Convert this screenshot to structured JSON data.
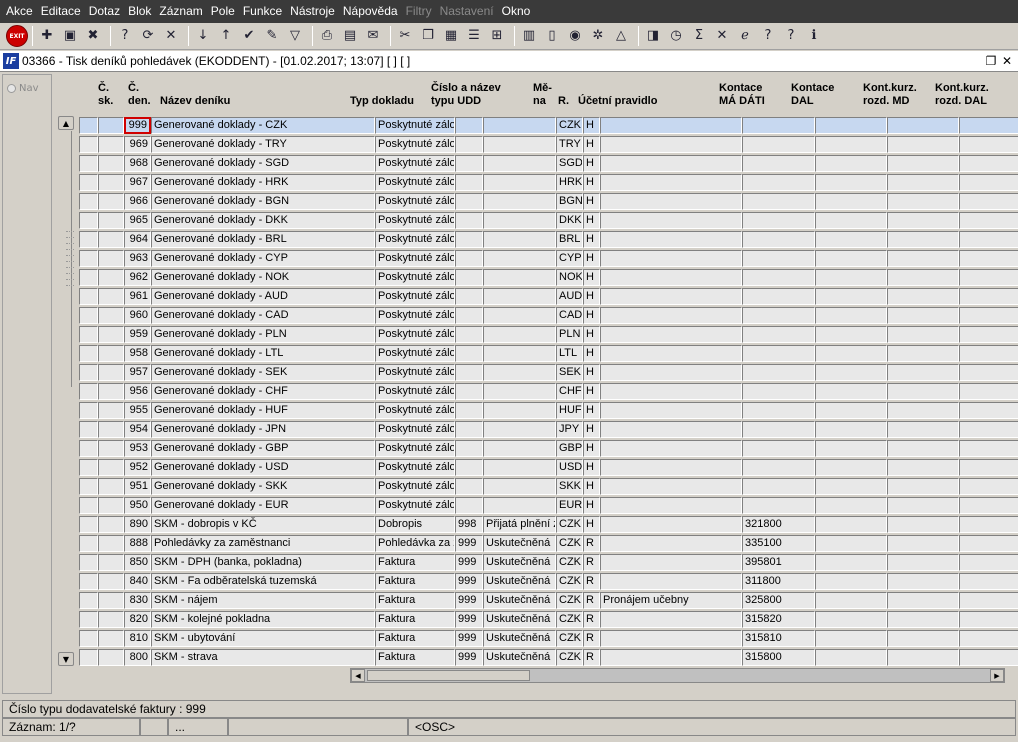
{
  "menu": [
    {
      "label": "Akce",
      "enabled": true
    },
    {
      "label": "Editace",
      "enabled": true
    },
    {
      "label": "Dotaz",
      "enabled": true
    },
    {
      "label": "Blok",
      "enabled": true
    },
    {
      "label": "Záznam",
      "enabled": true
    },
    {
      "label": "Pole",
      "enabled": true
    },
    {
      "label": "Funkce",
      "enabled": true
    },
    {
      "label": "Nástroje",
      "enabled": true
    },
    {
      "label": "Nápověda",
      "enabled": true
    },
    {
      "label": "Filtry",
      "enabled": false
    },
    {
      "label": "Nastavení",
      "enabled": false
    },
    {
      "label": "Okno",
      "enabled": true
    }
  ],
  "toolbar": {
    "exit_label": "EXIT",
    "icons": [
      {
        "name": "sep"
      },
      {
        "name": "insert-record-icon",
        "glyph": "✚"
      },
      {
        "name": "save-record-icon",
        "glyph": "▣"
      },
      {
        "name": "delete-record-icon",
        "glyph": "✖"
      },
      {
        "name": "sep"
      },
      {
        "name": "enter-query-icon",
        "glyph": "?"
      },
      {
        "name": "execute-query-icon",
        "glyph": "⟳"
      },
      {
        "name": "cancel-query-icon",
        "glyph": "✕"
      },
      {
        "name": "sep"
      },
      {
        "name": "sort-ascending-icon",
        "glyph": "↓"
      },
      {
        "name": "sort-descending-icon",
        "glyph": "↑"
      },
      {
        "name": "check-icon",
        "glyph": "✔"
      },
      {
        "name": "wrench-icon",
        "glyph": "✎"
      },
      {
        "name": "filter-icon",
        "glyph": "▽"
      },
      {
        "name": "sep"
      },
      {
        "name": "print-icon",
        "glyph": "⎙"
      },
      {
        "name": "print-preview-icon",
        "glyph": "▤"
      },
      {
        "name": "mail-icon",
        "glyph": "✉"
      },
      {
        "name": "sep"
      },
      {
        "name": "cut-icon",
        "glyph": "✂"
      },
      {
        "name": "copy-icon",
        "glyph": "❐"
      },
      {
        "name": "paste-icon",
        "glyph": "▦"
      },
      {
        "name": "list-icon",
        "glyph": "☰"
      },
      {
        "name": "tree-icon",
        "glyph": "⊞"
      },
      {
        "name": "sep"
      },
      {
        "name": "calculator-icon",
        "glyph": "▥"
      },
      {
        "name": "document-icon",
        "glyph": "▯"
      },
      {
        "name": "globe-icon",
        "glyph": "◉"
      },
      {
        "name": "settings-icon",
        "glyph": "✲"
      },
      {
        "name": "triangle-icon",
        "glyph": "△"
      },
      {
        "name": "sep"
      },
      {
        "name": "chart-icon",
        "glyph": "◨"
      },
      {
        "name": "clock-icon",
        "glyph": "◷"
      },
      {
        "name": "sum-icon",
        "glyph": "Σ"
      },
      {
        "name": "excel-icon",
        "glyph": "✕"
      },
      {
        "name": "internet-icon",
        "glyph": "ℯ"
      },
      {
        "name": "help-icon",
        "glyph": "?"
      },
      {
        "name": "question-icon",
        "glyph": "?"
      },
      {
        "name": "info-icon",
        "glyph": "ℹ"
      }
    ]
  },
  "window": {
    "icon_label": "IF",
    "title": "03366 - Tisk deníků pohledávek (EKODDENT) - [01.02.2017; 13:07] [ ] [ ]",
    "restore_glyph": "❐",
    "close_glyph": "✕"
  },
  "nav_label": "Nav",
  "columns": [
    {
      "key": "sk",
      "line1": "Č.",
      "line2": "sk."
    },
    {
      "key": "den",
      "line1": "Č.",
      "line2": "den."
    },
    {
      "key": "nazev",
      "line1": "",
      "line2": "Název deníku"
    },
    {
      "key": "typ",
      "line1": "",
      "line2": "Typ dokladu"
    },
    {
      "key": "udd",
      "line1": "Číslo a název",
      "line2": "typu UDD"
    },
    {
      "key": "mena",
      "line1": "Mě-",
      "line2": "na"
    },
    {
      "key": "r",
      "line1": "",
      "line2": "R."
    },
    {
      "key": "pravidlo",
      "line1": "",
      "line2": "Účetní pravidlo"
    },
    {
      "key": "madati",
      "line1": "Kontace",
      "line2": "MÁ DÁTI"
    },
    {
      "key": "dal",
      "line1": "Kontace",
      "line2": "DAL"
    },
    {
      "key": "kmd",
      "line1": "Kont.kurz.",
      "line2": "rozd. MD"
    },
    {
      "key": "kdal",
      "line1": "Kont.kurz.",
      "line2": "rozd. DAL"
    }
  ],
  "rows": [
    {
      "den": "999",
      "nazev": "Generované doklady - CZK",
      "typ": "Poskytnuté zálo",
      "udd_no": "",
      "udd_name": "",
      "mena": "CZK",
      "r": "H",
      "pravidlo": "",
      "madati": "",
      "selected": true
    },
    {
      "den": "969",
      "nazev": "Generované doklady - TRY",
      "typ": "Poskytnuté zálo",
      "udd_no": "",
      "udd_name": "",
      "mena": "TRY",
      "r": "H",
      "pravidlo": "",
      "madati": ""
    },
    {
      "den": "968",
      "nazev": "Generované doklady - SGD",
      "typ": "Poskytnuté zálo",
      "udd_no": "",
      "udd_name": "",
      "mena": "SGD",
      "r": "H",
      "pravidlo": "",
      "madati": ""
    },
    {
      "den": "967",
      "nazev": "Generované doklady - HRK",
      "typ": "Poskytnuté zálo",
      "udd_no": "",
      "udd_name": "",
      "mena": "HRK",
      "r": "H",
      "pravidlo": "",
      "madati": ""
    },
    {
      "den": "966",
      "nazev": "Generované doklady - BGN",
      "typ": "Poskytnuté zálo",
      "udd_no": "",
      "udd_name": "",
      "mena": "BGN",
      "r": "H",
      "pravidlo": "",
      "madati": ""
    },
    {
      "den": "965",
      "nazev": "Generované doklady - DKK",
      "typ": "Poskytnuté zálo",
      "udd_no": "",
      "udd_name": "",
      "mena": "DKK",
      "r": "H",
      "pravidlo": "",
      "madati": ""
    },
    {
      "den": "964",
      "nazev": "Generované doklady - BRL",
      "typ": "Poskytnuté zálo",
      "udd_no": "",
      "udd_name": "",
      "mena": "BRL",
      "r": "H",
      "pravidlo": "",
      "madati": ""
    },
    {
      "den": "963",
      "nazev": "Generované doklady - CYP",
      "typ": "Poskytnuté zálo",
      "udd_no": "",
      "udd_name": "",
      "mena": "CYP",
      "r": "H",
      "pravidlo": "",
      "madati": ""
    },
    {
      "den": "962",
      "nazev": "Generované doklady - NOK",
      "typ": "Poskytnuté zálo",
      "udd_no": "",
      "udd_name": "",
      "mena": "NOK",
      "r": "H",
      "pravidlo": "",
      "madati": ""
    },
    {
      "den": "961",
      "nazev": "Generované doklady - AUD",
      "typ": "Poskytnuté zálo",
      "udd_no": "",
      "udd_name": "",
      "mena": "AUD",
      "r": "H",
      "pravidlo": "",
      "madati": ""
    },
    {
      "den": "960",
      "nazev": "Generované doklady - CAD",
      "typ": "Poskytnuté zálo",
      "udd_no": "",
      "udd_name": "",
      "mena": "CAD",
      "r": "H",
      "pravidlo": "",
      "madati": ""
    },
    {
      "den": "959",
      "nazev": "Generované doklady - PLN",
      "typ": "Poskytnuté zálo",
      "udd_no": "",
      "udd_name": "",
      "mena": "PLN",
      "r": "H",
      "pravidlo": "",
      "madati": ""
    },
    {
      "den": "958",
      "nazev": "Generované doklady - LTL",
      "typ": "Poskytnuté zálo",
      "udd_no": "",
      "udd_name": "",
      "mena": "LTL",
      "r": "H",
      "pravidlo": "",
      "madati": ""
    },
    {
      "den": "957",
      "nazev": "Generované doklady - SEK",
      "typ": "Poskytnuté zálo",
      "udd_no": "",
      "udd_name": "",
      "mena": "SEK",
      "r": "H",
      "pravidlo": "",
      "madati": ""
    },
    {
      "den": "956",
      "nazev": "Generované doklady - CHF",
      "typ": "Poskytnuté zálo",
      "udd_no": "",
      "udd_name": "",
      "mena": "CHF",
      "r": "H",
      "pravidlo": "",
      "madati": ""
    },
    {
      "den": "955",
      "nazev": "Generované doklady - HUF",
      "typ": "Poskytnuté zálo",
      "udd_no": "",
      "udd_name": "",
      "mena": "HUF",
      "r": "H",
      "pravidlo": "",
      "madati": ""
    },
    {
      "den": "954",
      "nazev": "Generované doklady - JPN",
      "typ": "Poskytnuté zálo",
      "udd_no": "",
      "udd_name": "",
      "mena": "JPY",
      "r": "H",
      "pravidlo": "",
      "madati": ""
    },
    {
      "den": "953",
      "nazev": "Generované doklady - GBP",
      "typ": "Poskytnuté zálo",
      "udd_no": "",
      "udd_name": "",
      "mena": "GBP",
      "r": "H",
      "pravidlo": "",
      "madati": ""
    },
    {
      "den": "952",
      "nazev": "Generované doklady - USD",
      "typ": "Poskytnuté zálo",
      "udd_no": "",
      "udd_name": "",
      "mena": "USD",
      "r": "H",
      "pravidlo": "",
      "madati": ""
    },
    {
      "den": "951",
      "nazev": "Generované doklady - SKK",
      "typ": "Poskytnuté zálo",
      "udd_no": "",
      "udd_name": "",
      "mena": "SKK",
      "r": "H",
      "pravidlo": "",
      "madati": ""
    },
    {
      "den": "950",
      "nazev": "Generované doklady - EUR",
      "typ": "Poskytnuté zálo",
      "udd_no": "",
      "udd_name": "",
      "mena": "EUR",
      "r": "H",
      "pravidlo": "",
      "madati": ""
    },
    {
      "den": "890",
      "nazev": "SKM - dobropis v KČ",
      "typ": "Dobropis",
      "udd_no": "998",
      "udd_name": "Přijatá plnění z",
      "mena": "CZK",
      "r": "H",
      "pravidlo": "",
      "madati": "321800"
    },
    {
      "den": "888",
      "nazev": "Pohledávky za zaměstnanci",
      "typ": "Pohledávka za z",
      "udd_no": "999",
      "udd_name": "Uskutečněná",
      "mena": "CZK",
      "r": "R",
      "pravidlo": "",
      "madati": "335100"
    },
    {
      "den": "850",
      "nazev": "SKM - DPH  (banka, pokladna)",
      "typ": "Faktura",
      "udd_no": "999",
      "udd_name": "Uskutečněná",
      "mena": "CZK",
      "r": "R",
      "pravidlo": "",
      "madati": "395801"
    },
    {
      "den": "840",
      "nazev": "SKM - Fa odběratelská tuzemská",
      "typ": "Faktura",
      "udd_no": "999",
      "udd_name": "Uskutečněná",
      "mena": "CZK",
      "r": "R",
      "pravidlo": "",
      "madati": "311800"
    },
    {
      "den": "830",
      "nazev": "SKM - nájem",
      "typ": "Faktura",
      "udd_no": "999",
      "udd_name": "Uskutečněná",
      "mena": "CZK",
      "r": "R",
      "pravidlo": "Pronájem učebny",
      "madati": "325800"
    },
    {
      "den": "820",
      "nazev": "SKM - kolejné pokladna",
      "typ": "Faktura",
      "udd_no": "999",
      "udd_name": "Uskutečněná",
      "mena": "CZK",
      "r": "R",
      "pravidlo": "",
      "madati": "315820"
    },
    {
      "den": "810",
      "nazev": "SKM - ubytování",
      "typ": "Faktura",
      "udd_no": "999",
      "udd_name": "Uskutečněná",
      "mena": "CZK",
      "r": "R",
      "pravidlo": "",
      "madati": "315810"
    },
    {
      "den": "800",
      "nazev": "SKM - strava",
      "typ": "Faktura",
      "udd_no": "999",
      "udd_name": "Uskutečněná",
      "mena": "CZK",
      "r": "R",
      "pravidlo": "",
      "madati": "315800"
    }
  ],
  "status": {
    "hint": "Číslo typu dodavatelské faktury : 999",
    "record": "Záznam: 1/?",
    "seg2": "",
    "seg3": "...",
    "seg4": "",
    "osc": "<OSC>"
  }
}
